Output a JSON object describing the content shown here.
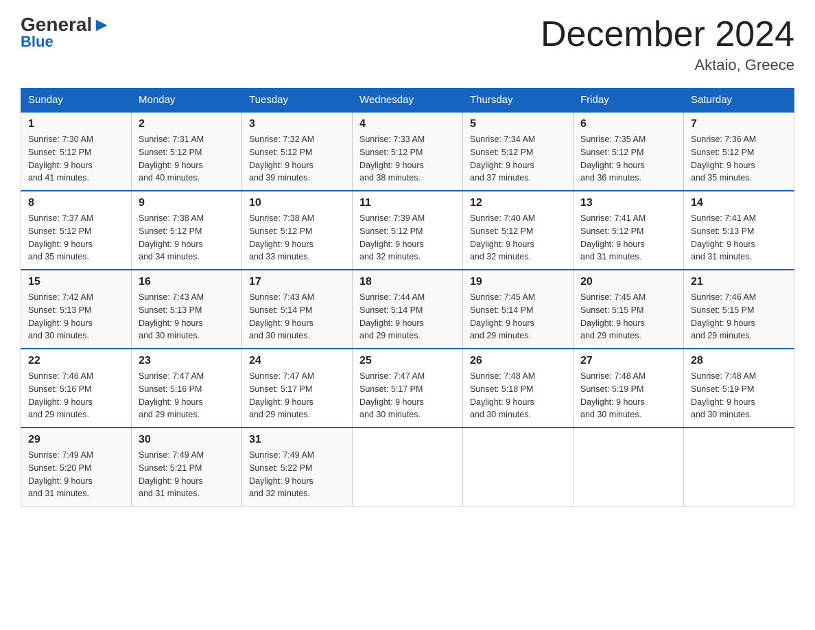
{
  "logo": {
    "general": "General",
    "blue": "Blue"
  },
  "title": "December 2024",
  "location": "Aktaio, Greece",
  "days_of_week": [
    "Sunday",
    "Monday",
    "Tuesday",
    "Wednesday",
    "Thursday",
    "Friday",
    "Saturday"
  ],
  "weeks": [
    [
      {
        "day": "1",
        "sunrise": "7:30 AM",
        "sunset": "5:12 PM",
        "daylight": "9 hours and 41 minutes."
      },
      {
        "day": "2",
        "sunrise": "7:31 AM",
        "sunset": "5:12 PM",
        "daylight": "9 hours and 40 minutes."
      },
      {
        "day": "3",
        "sunrise": "7:32 AM",
        "sunset": "5:12 PM",
        "daylight": "9 hours and 39 minutes."
      },
      {
        "day": "4",
        "sunrise": "7:33 AM",
        "sunset": "5:12 PM",
        "daylight": "9 hours and 38 minutes."
      },
      {
        "day": "5",
        "sunrise": "7:34 AM",
        "sunset": "5:12 PM",
        "daylight": "9 hours and 37 minutes."
      },
      {
        "day": "6",
        "sunrise": "7:35 AM",
        "sunset": "5:12 PM",
        "daylight": "9 hours and 36 minutes."
      },
      {
        "day": "7",
        "sunrise": "7:36 AM",
        "sunset": "5:12 PM",
        "daylight": "9 hours and 35 minutes."
      }
    ],
    [
      {
        "day": "8",
        "sunrise": "7:37 AM",
        "sunset": "5:12 PM",
        "daylight": "9 hours and 35 minutes."
      },
      {
        "day": "9",
        "sunrise": "7:38 AM",
        "sunset": "5:12 PM",
        "daylight": "9 hours and 34 minutes."
      },
      {
        "day": "10",
        "sunrise": "7:38 AM",
        "sunset": "5:12 PM",
        "daylight": "9 hours and 33 minutes."
      },
      {
        "day": "11",
        "sunrise": "7:39 AM",
        "sunset": "5:12 PM",
        "daylight": "9 hours and 32 minutes."
      },
      {
        "day": "12",
        "sunrise": "7:40 AM",
        "sunset": "5:12 PM",
        "daylight": "9 hours and 32 minutes."
      },
      {
        "day": "13",
        "sunrise": "7:41 AM",
        "sunset": "5:12 PM",
        "daylight": "9 hours and 31 minutes."
      },
      {
        "day": "14",
        "sunrise": "7:41 AM",
        "sunset": "5:13 PM",
        "daylight": "9 hours and 31 minutes."
      }
    ],
    [
      {
        "day": "15",
        "sunrise": "7:42 AM",
        "sunset": "5:13 PM",
        "daylight": "9 hours and 30 minutes."
      },
      {
        "day": "16",
        "sunrise": "7:43 AM",
        "sunset": "5:13 PM",
        "daylight": "9 hours and 30 minutes."
      },
      {
        "day": "17",
        "sunrise": "7:43 AM",
        "sunset": "5:14 PM",
        "daylight": "9 hours and 30 minutes."
      },
      {
        "day": "18",
        "sunrise": "7:44 AM",
        "sunset": "5:14 PM",
        "daylight": "9 hours and 29 minutes."
      },
      {
        "day": "19",
        "sunrise": "7:45 AM",
        "sunset": "5:14 PM",
        "daylight": "9 hours and 29 minutes."
      },
      {
        "day": "20",
        "sunrise": "7:45 AM",
        "sunset": "5:15 PM",
        "daylight": "9 hours and 29 minutes."
      },
      {
        "day": "21",
        "sunrise": "7:46 AM",
        "sunset": "5:15 PM",
        "daylight": "9 hours and 29 minutes."
      }
    ],
    [
      {
        "day": "22",
        "sunrise": "7:46 AM",
        "sunset": "5:16 PM",
        "daylight": "9 hours and 29 minutes."
      },
      {
        "day": "23",
        "sunrise": "7:47 AM",
        "sunset": "5:16 PM",
        "daylight": "9 hours and 29 minutes."
      },
      {
        "day": "24",
        "sunrise": "7:47 AM",
        "sunset": "5:17 PM",
        "daylight": "9 hours and 29 minutes."
      },
      {
        "day": "25",
        "sunrise": "7:47 AM",
        "sunset": "5:17 PM",
        "daylight": "9 hours and 30 minutes."
      },
      {
        "day": "26",
        "sunrise": "7:48 AM",
        "sunset": "5:18 PM",
        "daylight": "9 hours and 30 minutes."
      },
      {
        "day": "27",
        "sunrise": "7:48 AM",
        "sunset": "5:19 PM",
        "daylight": "9 hours and 30 minutes."
      },
      {
        "day": "28",
        "sunrise": "7:48 AM",
        "sunset": "5:19 PM",
        "daylight": "9 hours and 30 minutes."
      }
    ],
    [
      {
        "day": "29",
        "sunrise": "7:49 AM",
        "sunset": "5:20 PM",
        "daylight": "9 hours and 31 minutes."
      },
      {
        "day": "30",
        "sunrise": "7:49 AM",
        "sunset": "5:21 PM",
        "daylight": "9 hours and 31 minutes."
      },
      {
        "day": "31",
        "sunrise": "7:49 AM",
        "sunset": "5:22 PM",
        "daylight": "9 hours and 32 minutes."
      },
      null,
      null,
      null,
      null
    ]
  ],
  "labels": {
    "sunrise": "Sunrise: ",
    "sunset": "Sunset: ",
    "daylight": "Daylight: "
  }
}
